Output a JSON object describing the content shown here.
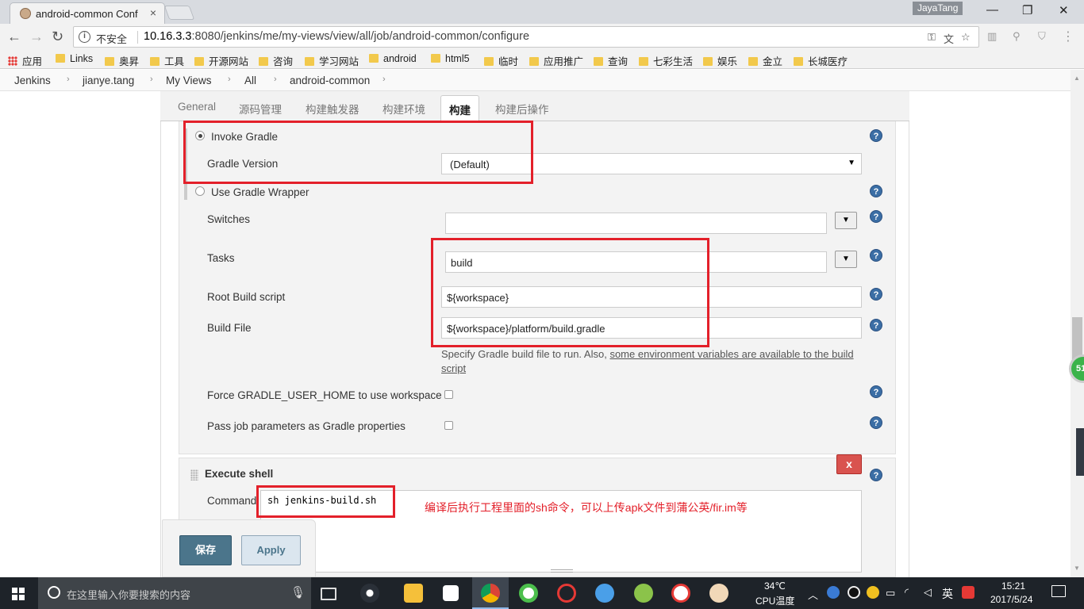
{
  "browser": {
    "tab_title": "android-common Conf",
    "tab_close": "×",
    "profile_name": "JayaTang",
    "window_minimize": "—",
    "window_restore": "❐",
    "window_close": "✕",
    "security_label": "不安全",
    "url_host": "10.16.3.3",
    "url_rest": ":8080/jenkins/me/my-views/view/all/job/android-common/configure"
  },
  "bookmarks": [
    {
      "label": "应用",
      "icon": "apps-grid-icon"
    },
    {
      "label": "Links"
    },
    {
      "label": "奥昇"
    },
    {
      "label": "工具"
    },
    {
      "label": "开源网站"
    },
    {
      "label": "咨询"
    },
    {
      "label": "学习网站"
    },
    {
      "label": "android"
    },
    {
      "label": "html5"
    },
    {
      "label": "临时"
    },
    {
      "label": "应用推广"
    },
    {
      "label": "查询"
    },
    {
      "label": "七彩生活"
    },
    {
      "label": "娱乐"
    },
    {
      "label": "金立"
    },
    {
      "label": "长城医疗"
    }
  ],
  "breadcrumb": [
    "Jenkins",
    "jianye.tang",
    "My Views",
    "All",
    "android-common"
  ],
  "config_tabs": [
    "General",
    "源码管理",
    "构建触发器",
    "构建环境",
    "构建",
    "构建后操作"
  ],
  "gradle": {
    "invoke_gradle_label": "Invoke Gradle",
    "gradle_version_label": "Gradle Version",
    "gradle_version_value": "(Default)",
    "use_wrapper_label": "Use Gradle Wrapper",
    "switches_label": "Switches",
    "switches_value": "",
    "tasks_label": "Tasks",
    "tasks_value": "build",
    "root_build_script_label": "Root Build script",
    "root_build_script_value": "${workspace}",
    "build_file_label": "Build File",
    "build_file_value": "${workspace}/platform/build.gradle",
    "build_file_help_prefix": "Specify Gradle build file to run. Also, ",
    "build_file_help_link": "some environment variables are available to the build script",
    "force_home_label": "Force GRADLE_USER_HOME to use workspace",
    "pass_params_label": "Pass job parameters as Gradle properties"
  },
  "shell": {
    "title": "Execute shell",
    "delete_label": "x",
    "command_label": "Command",
    "command_value": "sh jenkins-build.sh",
    "annotation": "编译后执行工程里面的sh命令，可以上传apk文件到蒲公英/fir.im等"
  },
  "buttons": {
    "save": "保存",
    "apply": "Apply"
  },
  "help_glyph": "?",
  "dropdown_glyph": "▼",
  "side_badge": "51",
  "taskbar": {
    "search_placeholder": "在这里输入你要搜索的内容",
    "temperature": "34℃",
    "cpu_label": "CPU温度",
    "ime": "英",
    "time": "15:21",
    "date": "2017/5/24"
  },
  "colors": {
    "annotation_red": "#e3202a",
    "save_button": "#4b758b",
    "help_blue": "#3b6ea5",
    "delete_red": "#d9534f"
  }
}
